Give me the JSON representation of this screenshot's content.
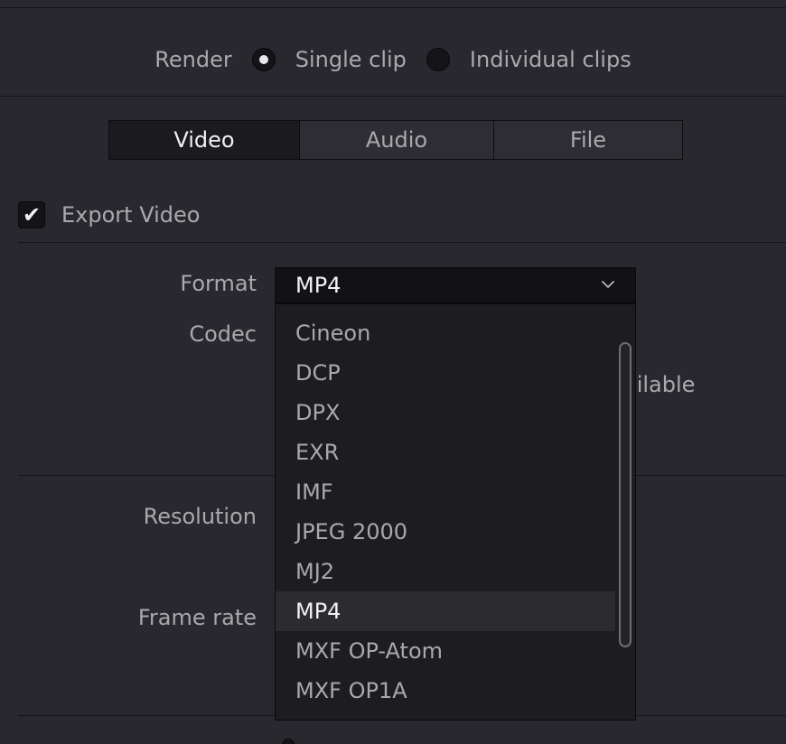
{
  "render": {
    "label": "Render",
    "options": [
      {
        "label": "Single clip",
        "selected": true
      },
      {
        "label": "Individual clips",
        "selected": false
      }
    ]
  },
  "tabs": [
    {
      "label": "Video",
      "active": true
    },
    {
      "label": "Audio",
      "active": false
    },
    {
      "label": "File",
      "active": false
    }
  ],
  "export_video": {
    "label": "Export Video",
    "checked": true,
    "check_glyph": "✔"
  },
  "fields": {
    "format_label": "Format",
    "codec_label": "Codec",
    "resolution_label": "Resolution",
    "frame_rate_label": "Frame rate",
    "partially_hidden_text": "ailable"
  },
  "format_select": {
    "value": "MP4",
    "options": [
      "Cineon",
      "DCP",
      "DPX",
      "EXR",
      "IMF",
      "JPEG 2000",
      "MJ2",
      "MP4",
      "MXF OP-Atom",
      "MXF OP1A"
    ],
    "selected_index": 7
  },
  "icons": {
    "chevron": "chevron-down-icon",
    "check": "checkmark-icon"
  },
  "colors": {
    "background": "#28282e",
    "field": "#121215",
    "selected_option": "#2b2b30",
    "text": "#a9a9ad",
    "text_active": "#f2f2f4"
  }
}
